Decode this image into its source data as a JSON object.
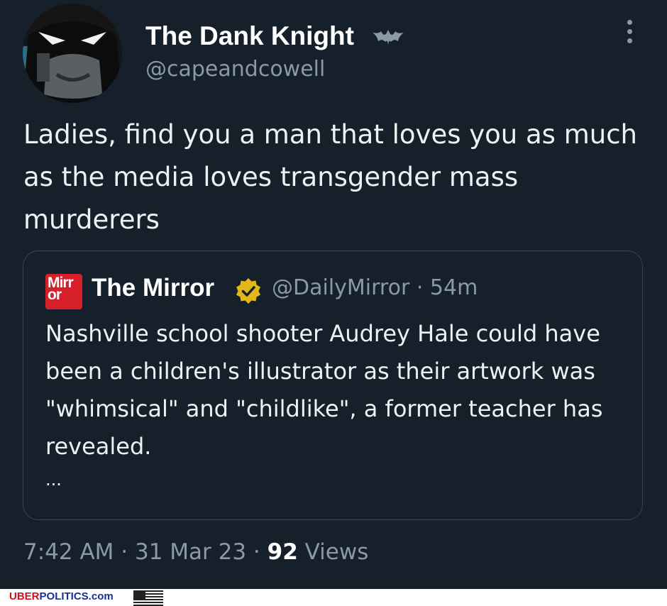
{
  "tweet": {
    "author": {
      "display_name": "The Dank Knight",
      "handle": "@capeandcowell",
      "avatar_icon": "batman-mask-avatar",
      "badge_icon": "bat-icon"
    },
    "menu_icon": "more-vertical-icon",
    "text": "Ladies, find you a man that loves you as much as the media loves transgender mass murderers",
    "quoted": {
      "logo_text": "Mirror",
      "logo_color": "#d6202a",
      "name": "The Mirror",
      "verified_icon": "verified-gold-badge-icon",
      "verified_color": "#e2b719",
      "handle_time": "@DailyMirror · 54m",
      "text": "Nashville school shooter Audrey Hale could have been a children's illustrator as their artwork was \"whimsical\" and \"childlike\", a former teacher has revealed.",
      "ellipsis": "..."
    },
    "meta": {
      "time_date": "7:42 AM · 31 Mar 23 · ",
      "views_count": "92",
      "views_label": " Views"
    }
  },
  "footer": {
    "brand_part1": "UBER",
    "brand_part2": "POLITICS.com",
    "flag_icon": "us-flag-icon"
  },
  "colors": {
    "background": "#15202b",
    "secondary_text": "#8b98a5",
    "border": "#38444d"
  }
}
